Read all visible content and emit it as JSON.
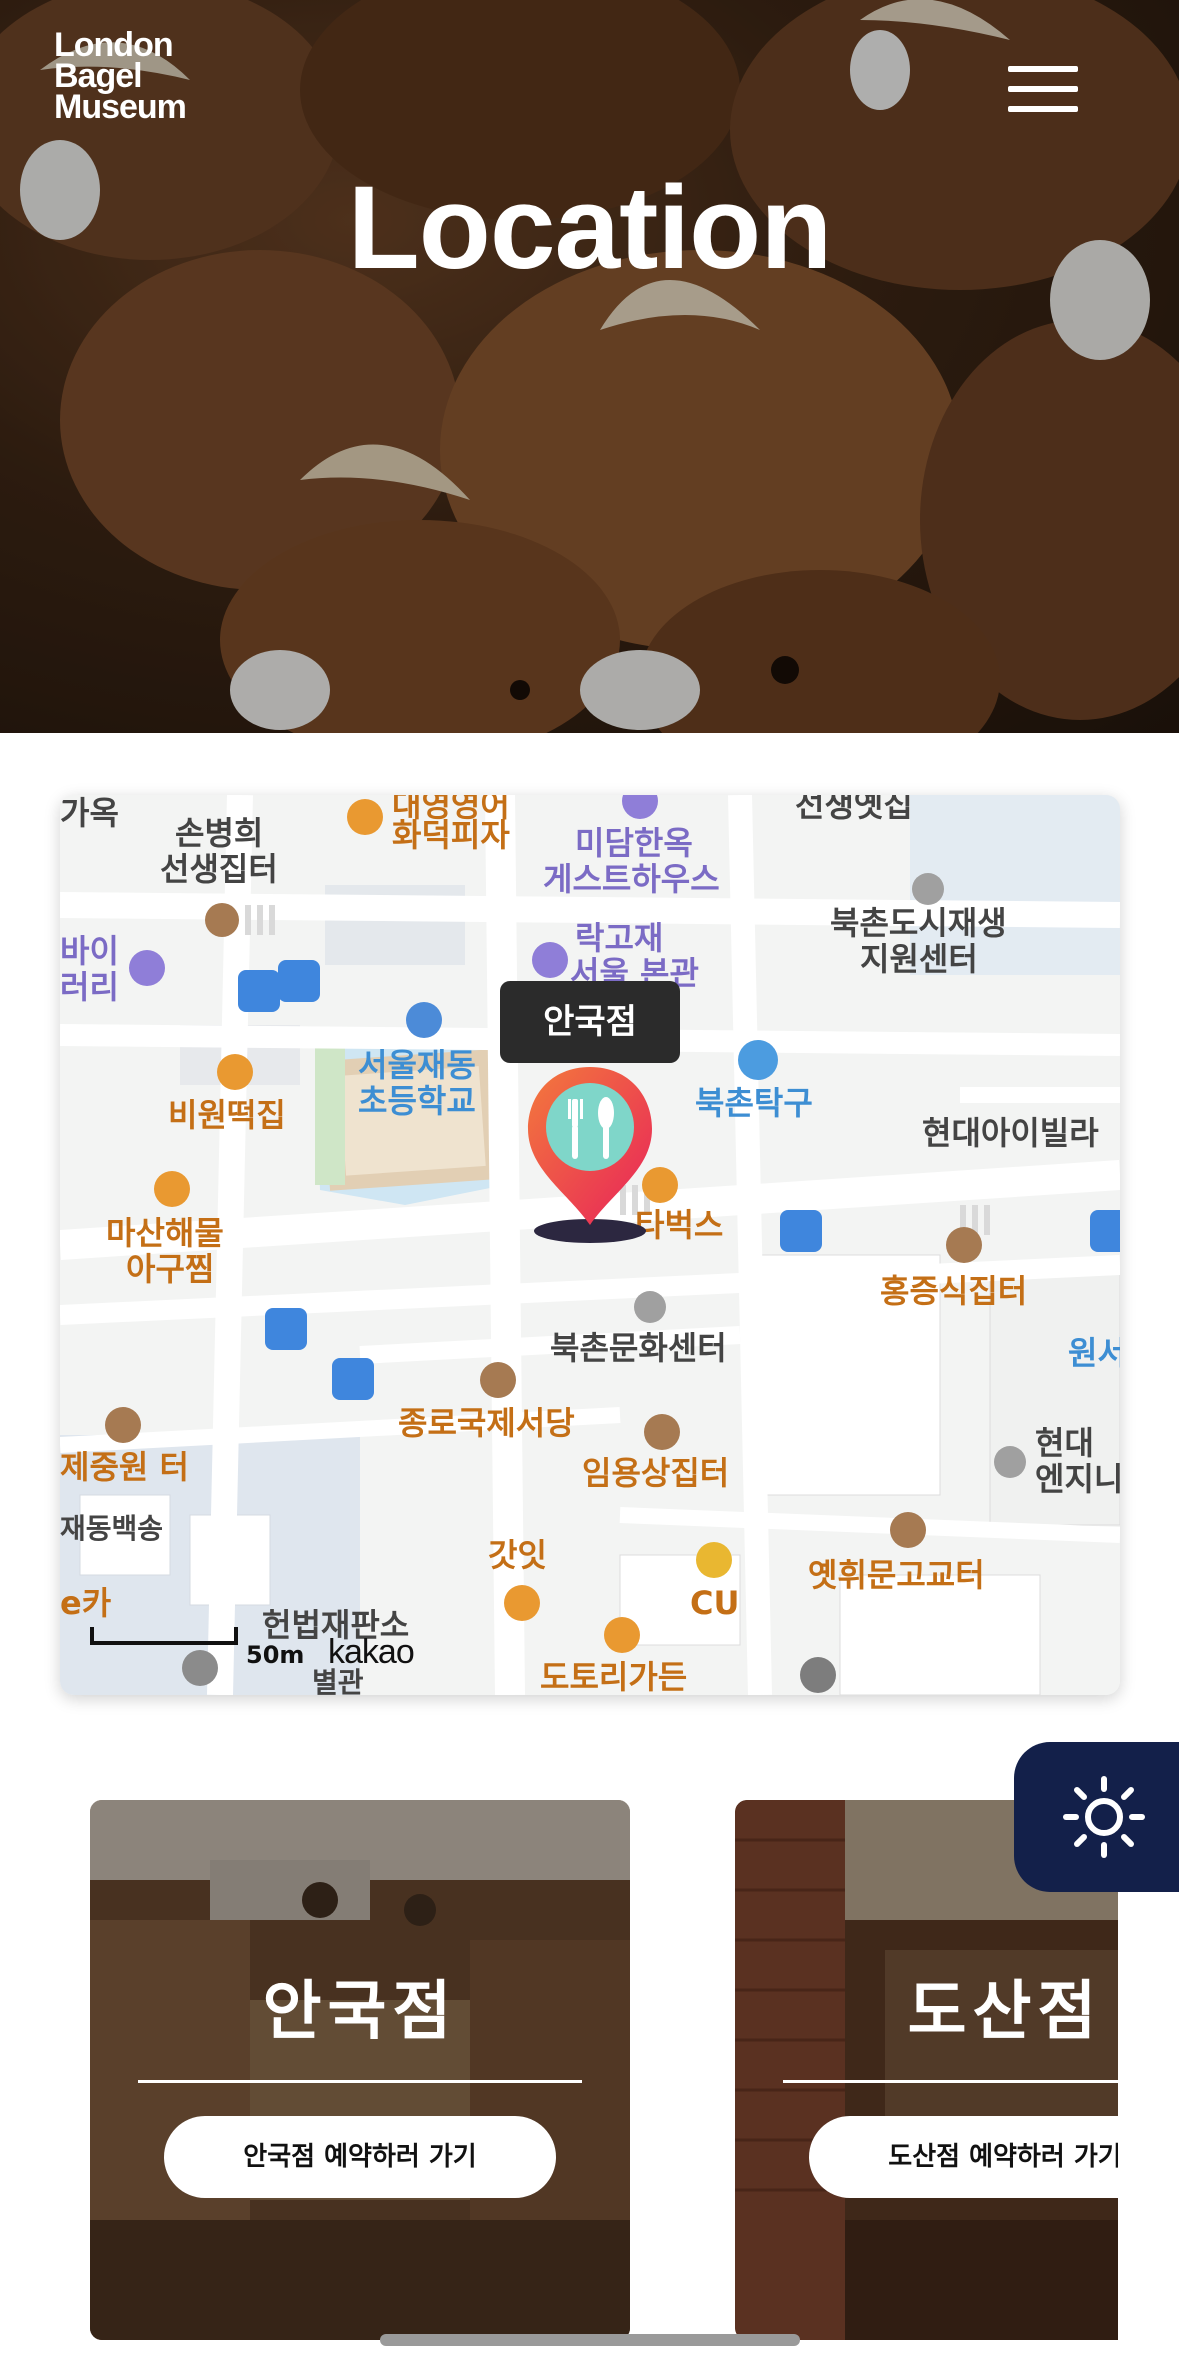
{
  "header": {
    "logo_lines": [
      "London",
      "Bagel",
      "Museum"
    ],
    "menu_icon": "hamburger-icon",
    "title": "Location"
  },
  "map": {
    "selected_pin_label": "안국점",
    "pin_icon": "restaurant-pin-icon",
    "scale_text": "50m",
    "provider": "kakao",
    "labels": {
      "gayuk": "가옥",
      "sonbyeonghui_1": "손병희",
      "sonbyeonghui_2": "선생집터",
      "pizza_1": "대영영어",
      "pizza_2": "화덕피자",
      "midam_1": "미담한옥",
      "midam_2": "게스트하우스",
      "seonsaeng": "선생옛집",
      "rakgojae_1": "락고재",
      "rakgojae_2": "서울 본관",
      "bukchon_center_1": "북촌도시재생",
      "bukchon_center_2": "지원센터",
      "bai_1": "바이",
      "bai_2": "러리",
      "school_1": "서울재동",
      "school_2": "초등학교",
      "biwon": "비원떡집",
      "bukchon_takgu": "북촌탁구",
      "hyundai_villa": "현대아이빌라",
      "masan_1": "마산해물",
      "masan_2": "아구찜",
      "starbucks": "타벅스",
      "hongjeung": "홍증식집터",
      "bukchon_culture": "북촌문화센터",
      "won": "원서",
      "jongno": "종로국제서당",
      "imyongsang": "임용상집터",
      "hyundai_eng_1": "현대",
      "hyundai_eng_2": "엔지니",
      "jejungwon": "제중원 터",
      "jaedong": "재동백송",
      "gatit": "갓잇",
      "cu": "CU",
      "okhwi": "옛휘문고교터",
      "ka": "e카",
      "court": "헌법재판소",
      "dotori": "도토리가든",
      "bottom_cut": "별관"
    }
  },
  "branches": [
    {
      "name": "안국점",
      "button_label": "안국점 예약하러 가기"
    },
    {
      "name": "도산점",
      "button_label": "도산점 예약하러 가기"
    }
  ],
  "theme_toggle_icon": "sun-icon"
}
